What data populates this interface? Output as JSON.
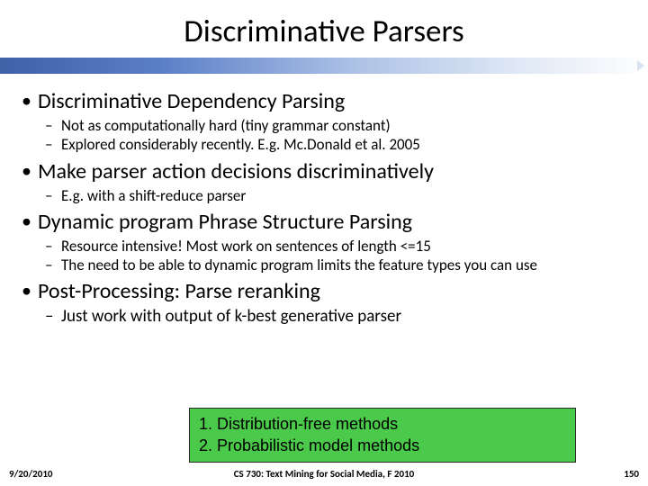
{
  "title": "Discriminative Parsers",
  "bullets": {
    "p1": "Discriminative Dependency Parsing",
    "p1a": "Not as computationally hard (tiny grammar constant)",
    "p1b": "Explored considerably recently. E.g. Mc.Donald et al. 2005",
    "p2": "Make parser action decisions discriminatively",
    "p2a": "E.g. with a shift-reduce parser",
    "p3": "Dynamic program Phrase Structure Parsing",
    "p3a": "Resource intensive! Most work on sentences of length <=15",
    "p3b": "The need to be able to dynamic program limits the feature types you can use",
    "p4": "Post-Processing: Parse reranking",
    "p4a": "Just work with output of k-best generative parser"
  },
  "box": {
    "line1": "1. Distribution-free methods",
    "line2": "2. Probabilistic model methods"
  },
  "footer": {
    "date": "9/20/2010",
    "course": "CS 730: Text Mining for Social Media, F 2010",
    "page": "150"
  }
}
